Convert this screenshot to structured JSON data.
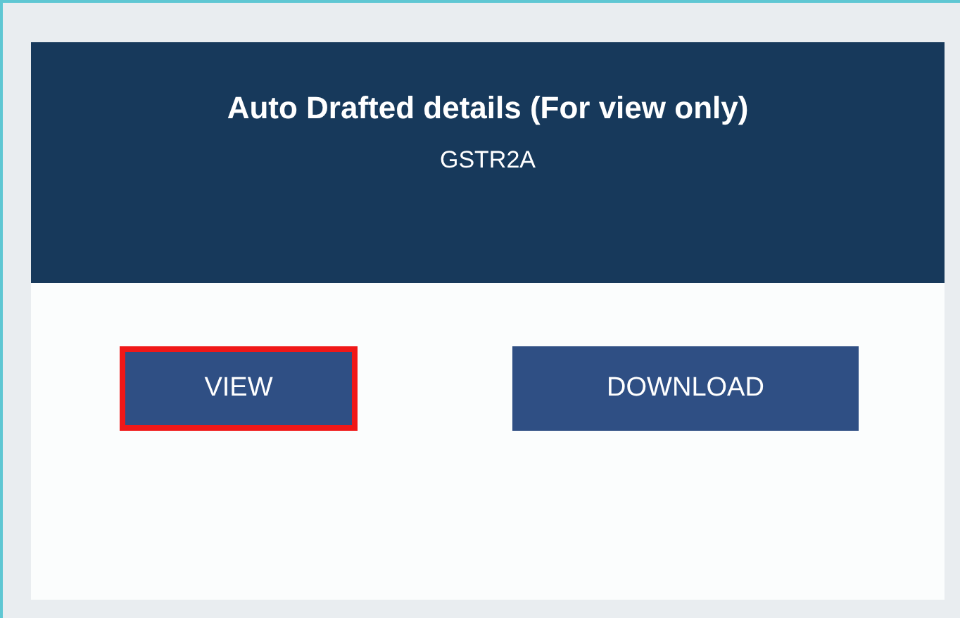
{
  "card": {
    "title": "Auto Drafted details (For view only)",
    "subtitle": "GSTR2A",
    "buttons": [
      {
        "label": "VIEW",
        "highlighted": true
      },
      {
        "label": "DOWNLOAD",
        "highlighted": false
      }
    ]
  }
}
